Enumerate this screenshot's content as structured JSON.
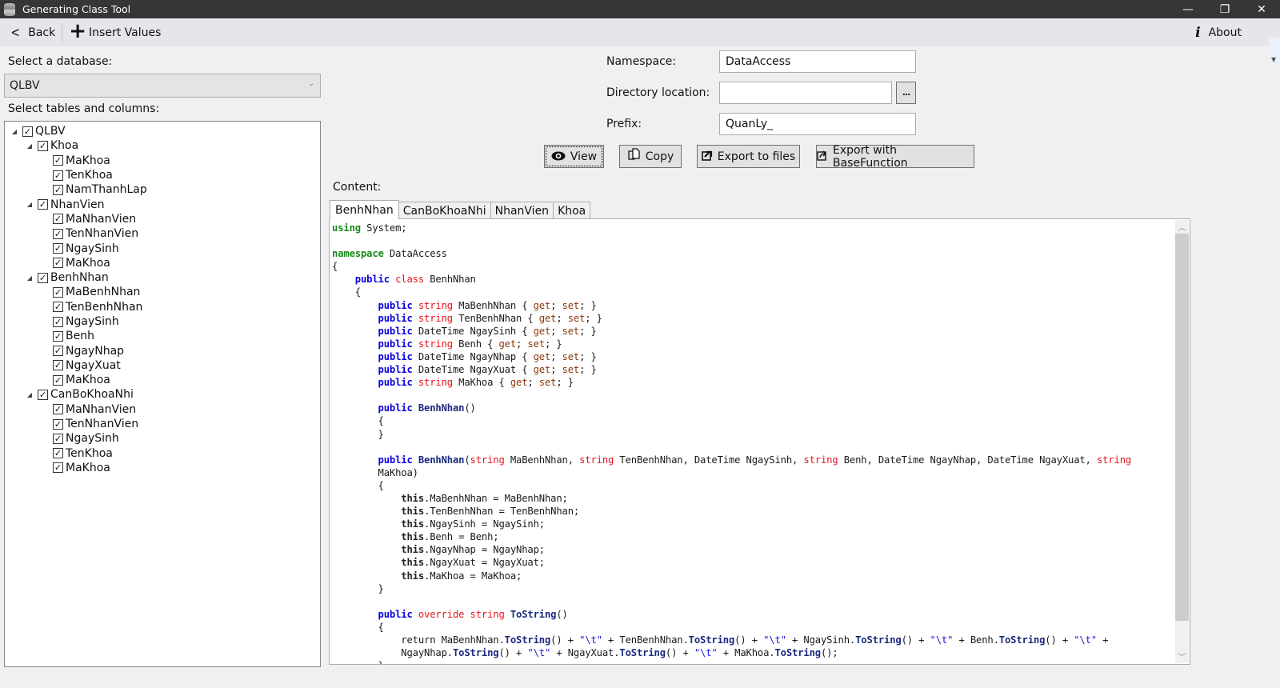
{
  "window": {
    "title": "Generating Class Tool",
    "controls": {
      "minimize": "—",
      "restore": "❐",
      "close": "✕"
    }
  },
  "toolbar": {
    "back_label": "Back",
    "insert_label": "Insert Values",
    "about_label": "About"
  },
  "left": {
    "db_label": "Select a database:",
    "db_selected": "QLBV",
    "tree_label": "Select tables and columns:",
    "tree": [
      {
        "level": 0,
        "label": "QLBV",
        "expanded": true,
        "checked": true
      },
      {
        "level": 1,
        "label": "Khoa",
        "expanded": true,
        "checked": true
      },
      {
        "level": 2,
        "label": "MaKhoa",
        "checked": true
      },
      {
        "level": 2,
        "label": "TenKhoa",
        "checked": true
      },
      {
        "level": 2,
        "label": "NamThanhLap",
        "checked": true
      },
      {
        "level": 1,
        "label": "NhanVien",
        "expanded": true,
        "checked": true
      },
      {
        "level": 2,
        "label": "MaNhanVien",
        "checked": true
      },
      {
        "level": 2,
        "label": "TenNhanVien",
        "checked": true
      },
      {
        "level": 2,
        "label": "NgaySinh",
        "checked": true
      },
      {
        "level": 2,
        "label": "MaKhoa",
        "checked": true
      },
      {
        "level": 1,
        "label": "BenhNhan",
        "expanded": true,
        "checked": true
      },
      {
        "level": 2,
        "label": "MaBenhNhan",
        "checked": true
      },
      {
        "level": 2,
        "label": "TenBenhNhan",
        "checked": true
      },
      {
        "level": 2,
        "label": "NgaySinh",
        "checked": true
      },
      {
        "level": 2,
        "label": "Benh",
        "checked": true
      },
      {
        "level": 2,
        "label": "NgayNhap",
        "checked": true
      },
      {
        "level": 2,
        "label": "NgayXuat",
        "checked": true
      },
      {
        "level": 2,
        "label": "MaKhoa",
        "checked": true
      },
      {
        "level": 1,
        "label": "CanBoKhoaNhi",
        "expanded": true,
        "checked": true
      },
      {
        "level": 2,
        "label": "MaNhanVien",
        "checked": true
      },
      {
        "level": 2,
        "label": "TenNhanVien",
        "checked": true
      },
      {
        "level": 2,
        "label": "NgaySinh",
        "checked": true
      },
      {
        "level": 2,
        "label": "TenKhoa",
        "checked": true
      },
      {
        "level": 2,
        "label": "MaKhoa",
        "checked": true
      }
    ]
  },
  "form": {
    "namespace_label": "Namespace:",
    "namespace_value": "DataAccess",
    "directory_label": "Directory location:",
    "directory_value": "",
    "browse_label": "...",
    "prefix_label": "Prefix:",
    "prefix_value": "QuanLy_"
  },
  "actions": {
    "view": "View",
    "copy": "Copy",
    "export_files": "Export to files",
    "export_base": "Export with BaseFunction"
  },
  "content": {
    "label": "Content:",
    "tabs": [
      "BenhNhan",
      "CanBoKhoaNhi",
      "NhanVien",
      "Khoa"
    ],
    "active_tab": "BenhNhan",
    "code_lines": [
      [
        [
          "using",
          "green"
        ],
        [
          " System;",
          ""
        ]
      ],
      [],
      [
        [
          "namespace",
          "green"
        ],
        [
          " DataAccess",
          ""
        ]
      ],
      [
        [
          "{",
          ""
        ]
      ],
      [
        [
          "    ",
          ""
        ],
        [
          "public",
          "blue"
        ],
        [
          " ",
          ""
        ],
        [
          "class",
          "red"
        ],
        [
          " BenhNhan",
          ""
        ]
      ],
      [
        [
          "    {",
          ""
        ]
      ],
      [
        [
          "        ",
          ""
        ],
        [
          "public",
          "blue"
        ],
        [
          " ",
          ""
        ],
        [
          "string",
          "red"
        ],
        [
          " MaBenhNhan { ",
          ""
        ],
        [
          "get",
          "brown"
        ],
        [
          "; ",
          ""
        ],
        [
          "set",
          "brown"
        ],
        [
          "; }",
          ""
        ]
      ],
      [
        [
          "        ",
          ""
        ],
        [
          "public",
          "blue"
        ],
        [
          " ",
          ""
        ],
        [
          "string",
          "red"
        ],
        [
          " TenBenhNhan { ",
          ""
        ],
        [
          "get",
          "brown"
        ],
        [
          "; ",
          ""
        ],
        [
          "set",
          "brown"
        ],
        [
          "; }",
          ""
        ]
      ],
      [
        [
          "        ",
          ""
        ],
        [
          "public",
          "blue"
        ],
        [
          " DateTime NgaySinh { ",
          ""
        ],
        [
          "get",
          "brown"
        ],
        [
          "; ",
          ""
        ],
        [
          "set",
          "brown"
        ],
        [
          "; }",
          ""
        ]
      ],
      [
        [
          "        ",
          ""
        ],
        [
          "public",
          "blue"
        ],
        [
          " ",
          ""
        ],
        [
          "string",
          "red"
        ],
        [
          " Benh { ",
          ""
        ],
        [
          "get",
          "brown"
        ],
        [
          "; ",
          ""
        ],
        [
          "set",
          "brown"
        ],
        [
          "; }",
          ""
        ]
      ],
      [
        [
          "        ",
          ""
        ],
        [
          "public",
          "blue"
        ],
        [
          " DateTime NgayNhap { ",
          ""
        ],
        [
          "get",
          "brown"
        ],
        [
          "; ",
          ""
        ],
        [
          "set",
          "brown"
        ],
        [
          "; }",
          ""
        ]
      ],
      [
        [
          "        ",
          ""
        ],
        [
          "public",
          "blue"
        ],
        [
          " DateTime NgayXuat { ",
          ""
        ],
        [
          "get",
          "brown"
        ],
        [
          "; ",
          ""
        ],
        [
          "set",
          "brown"
        ],
        [
          "; }",
          ""
        ]
      ],
      [
        [
          "        ",
          ""
        ],
        [
          "public",
          "blue"
        ],
        [
          " ",
          ""
        ],
        [
          "string",
          "red"
        ],
        [
          " MaKhoa { ",
          ""
        ],
        [
          "get",
          "brown"
        ],
        [
          "; ",
          ""
        ],
        [
          "set",
          "brown"
        ],
        [
          "; }",
          ""
        ]
      ],
      [],
      [
        [
          "        ",
          ""
        ],
        [
          "public",
          "blue"
        ],
        [
          " ",
          ""
        ],
        [
          "BenhNhan",
          "navy"
        ],
        [
          "()",
          ""
        ]
      ],
      [
        [
          "        {",
          ""
        ]
      ],
      [
        [
          "        }",
          ""
        ]
      ],
      [],
      [
        [
          "        ",
          ""
        ],
        [
          "public",
          "blue"
        ],
        [
          " ",
          ""
        ],
        [
          "BenhNhan",
          "navy"
        ],
        [
          "(",
          ""
        ],
        [
          "string",
          "red"
        ],
        [
          " MaBenhNhan, ",
          ""
        ],
        [
          "string",
          "red"
        ],
        [
          " TenBenhNhan, DateTime NgaySinh, ",
          ""
        ],
        [
          "string",
          "red"
        ],
        [
          " Benh, DateTime NgayNhap, DateTime NgayXuat, ",
          ""
        ],
        [
          "string",
          "red"
        ]
      ],
      [
        [
          "        MaKhoa)",
          ""
        ]
      ],
      [
        [
          "        {",
          ""
        ]
      ],
      [
        [
          "            ",
          ""
        ],
        [
          "this",
          "bold"
        ],
        [
          ".MaBenhNhan = MaBenhNhan;",
          ""
        ]
      ],
      [
        [
          "            ",
          ""
        ],
        [
          "this",
          "bold"
        ],
        [
          ".TenBenhNhan = TenBenhNhan;",
          ""
        ]
      ],
      [
        [
          "            ",
          ""
        ],
        [
          "this",
          "bold"
        ],
        [
          ".NgaySinh = NgaySinh;",
          ""
        ]
      ],
      [
        [
          "            ",
          ""
        ],
        [
          "this",
          "bold"
        ],
        [
          ".Benh = Benh;",
          ""
        ]
      ],
      [
        [
          "            ",
          ""
        ],
        [
          "this",
          "bold"
        ],
        [
          ".NgayNhap = NgayNhap;",
          ""
        ]
      ],
      [
        [
          "            ",
          ""
        ],
        [
          "this",
          "bold"
        ],
        [
          ".NgayXuat = NgayXuat;",
          ""
        ]
      ],
      [
        [
          "            ",
          ""
        ],
        [
          "this",
          "bold"
        ],
        [
          ".MaKhoa = MaKhoa;",
          ""
        ]
      ],
      [
        [
          "        }",
          ""
        ]
      ],
      [],
      [
        [
          "        ",
          ""
        ],
        [
          "public",
          "blue"
        ],
        [
          " ",
          ""
        ],
        [
          "override",
          "red"
        ],
        [
          " ",
          ""
        ],
        [
          "string",
          "red"
        ],
        [
          " ",
          ""
        ],
        [
          "ToString",
          "navy"
        ],
        [
          "()",
          ""
        ]
      ],
      [
        [
          "        {",
          ""
        ]
      ],
      [
        [
          "            return MaBenhNhan.",
          ""
        ],
        [
          "ToString",
          "navy"
        ],
        [
          "() + ",
          ""
        ],
        [
          "\"\\t\"",
          "str"
        ],
        [
          " + TenBenhNhan.",
          ""
        ],
        [
          "ToString",
          "navy"
        ],
        [
          "() + ",
          ""
        ],
        [
          "\"\\t\"",
          "str"
        ],
        [
          " + NgaySinh.",
          ""
        ],
        [
          "ToString",
          "navy"
        ],
        [
          "() + ",
          ""
        ],
        [
          "\"\\t\"",
          "str"
        ],
        [
          " + Benh.",
          ""
        ],
        [
          "ToString",
          "navy"
        ],
        [
          "() + ",
          ""
        ],
        [
          "\"\\t\"",
          "str"
        ],
        [
          " +",
          ""
        ]
      ],
      [
        [
          "            NgayNhap.",
          ""
        ],
        [
          "ToString",
          "navy"
        ],
        [
          "() + ",
          ""
        ],
        [
          "\"\\t\"",
          "str"
        ],
        [
          " + NgayXuat.",
          ""
        ],
        [
          "ToString",
          "navy"
        ],
        [
          "() + ",
          ""
        ],
        [
          "\"\\t\"",
          "str"
        ],
        [
          " + MaKhoa.",
          ""
        ],
        [
          "ToString",
          "navy"
        ],
        [
          "();",
          ""
        ]
      ],
      [
        [
          "        }",
          ""
        ]
      ]
    ]
  }
}
